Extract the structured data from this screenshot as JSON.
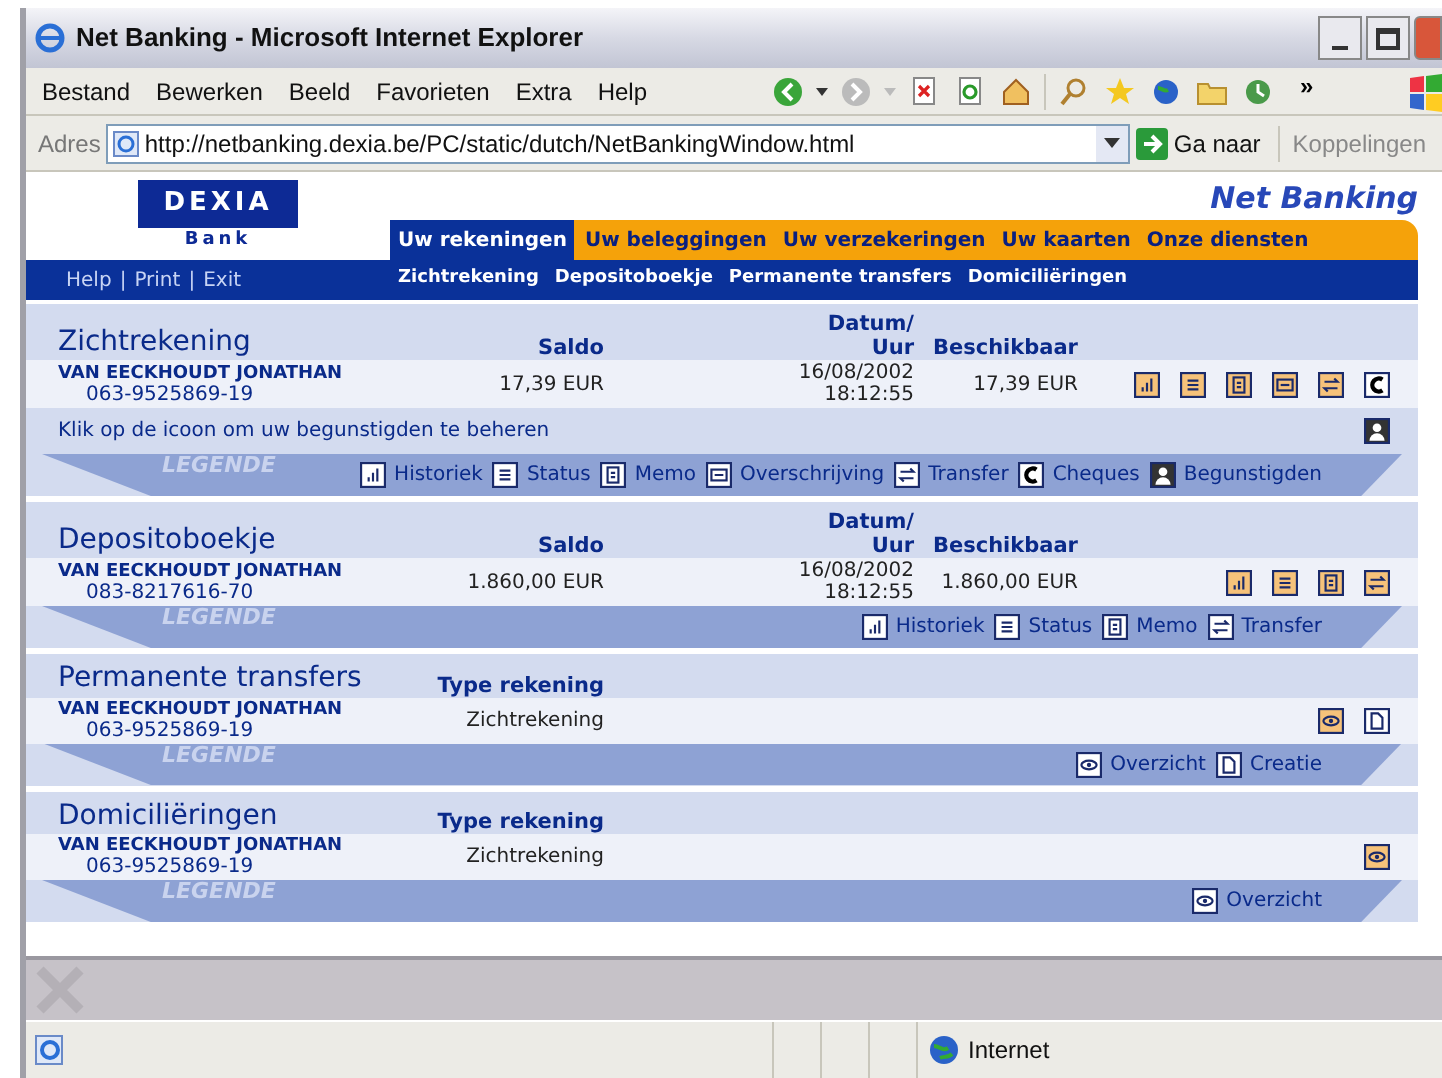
{
  "window": {
    "title": "Net Banking - Microsoft Internet Explorer"
  },
  "menu": [
    "Bestand",
    "Bewerken",
    "Beeld",
    "Favorieten",
    "Extra",
    "Help"
  ],
  "toolbar_overflow": "»",
  "address": {
    "label": "Adres",
    "url": "http://netbanking.dexia.be/PC/static/dutch/NetBankingWindow.html",
    "go": "Ga naar",
    "links": "Koppelingen"
  },
  "page": {
    "logo": {
      "name": "DEXIA",
      "sub": "Bank"
    },
    "brand": "Net Banking",
    "tabs": [
      {
        "label": "Uw rekeningen",
        "selected": true
      },
      {
        "label": "Uw beleggingen",
        "selected": false
      },
      {
        "label": "Uw verzekeringen",
        "selected": false
      },
      {
        "label": "Uw kaarten",
        "selected": false
      },
      {
        "label": "Onze diensten",
        "selected": false
      }
    ],
    "util_links": [
      "Help",
      "Print",
      "Exit"
    ],
    "separator": "|",
    "subnav": [
      "Zichtrekening",
      "Depositoboekje",
      "Permanente transfers",
      "Domiciliëringen"
    ],
    "sections": [
      {
        "title": "Zichtrekening",
        "columns": [
          "Saldo",
          "Datum/\nUur",
          "Beschikbaar"
        ],
        "rows": [
          {
            "holder": "VAN EECKHOUDT JONATHAN",
            "account": "063-9525869-19",
            "cells": [
              "17,39 EUR",
              "16/08/2002\n18:12:55",
              "17,39 EUR"
            ],
            "actions": [
              {
                "kind": "historiek"
              },
              {
                "kind": "status"
              },
              {
                "kind": "memo"
              },
              {
                "kind": "overschrijving"
              },
              {
                "kind": "transfer"
              },
              {
                "kind": "cheques"
              }
            ]
          }
        ],
        "note": {
          "text": "Klik op de icoon om uw begunstigden te beheren",
          "kind": "begunstigden"
        },
        "legend_title": "LEGENDE",
        "legend": [
          {
            "kind": "historiek",
            "label": "Historiek"
          },
          {
            "kind": "status",
            "label": "Status"
          },
          {
            "kind": "memo",
            "label": "Memo"
          },
          {
            "kind": "overschrijving",
            "label": "Overschrijving"
          },
          {
            "kind": "transfer",
            "label": "Transfer"
          },
          {
            "kind": "cheques",
            "label": "Cheques"
          },
          {
            "kind": "begunstigden",
            "label": "Begunstigden"
          }
        ]
      },
      {
        "title": "Depositoboekje",
        "columns": [
          "Saldo",
          "Datum/\nUur",
          "Beschikbaar"
        ],
        "rows": [
          {
            "holder": "VAN EECKHOUDT JONATHAN",
            "account": "083-8217616-70",
            "cells": [
              "1.860,00 EUR",
              "16/08/2002\n18:12:55",
              "1.860,00 EUR"
            ],
            "actions": [
              {
                "kind": "historiek"
              },
              {
                "kind": "status"
              },
              {
                "kind": "memo"
              },
              {
                "kind": "transfer"
              }
            ]
          }
        ],
        "legend_title": "LEGENDE",
        "legend": [
          {
            "kind": "historiek",
            "label": "Historiek"
          },
          {
            "kind": "status",
            "label": "Status"
          },
          {
            "kind": "memo",
            "label": "Memo"
          },
          {
            "kind": "transfer",
            "label": "Transfer"
          }
        ]
      },
      {
        "title": "Permanente transfers",
        "columns": [
          "Type rekening"
        ],
        "rows": [
          {
            "holder": "VAN EECKHOUDT JONATHAN",
            "account": "063-9525869-19",
            "cells": [
              "Zichtrekening"
            ],
            "actions": [
              {
                "kind": "overzicht"
              },
              {
                "kind": "creatie"
              }
            ]
          }
        ],
        "legend_title": "LEGENDE",
        "legend": [
          {
            "kind": "overzicht",
            "label": "Overzicht"
          },
          {
            "kind": "creatie",
            "label": "Creatie"
          }
        ]
      },
      {
        "title": "Domiciliëringen",
        "columns": [
          "Type rekening"
        ],
        "rows": [
          {
            "holder": "VAN EECKHOUDT JONATHAN",
            "account": "063-9525869-19",
            "cells": [
              "Zichtrekening"
            ],
            "actions": [
              {
                "kind": "overzicht"
              }
            ]
          }
        ],
        "legend_title": "LEGENDE",
        "legend": [
          {
            "kind": "overzicht",
            "label": "Overzicht"
          }
        ]
      }
    ]
  },
  "status_bar": {
    "zone": "Internet"
  }
}
